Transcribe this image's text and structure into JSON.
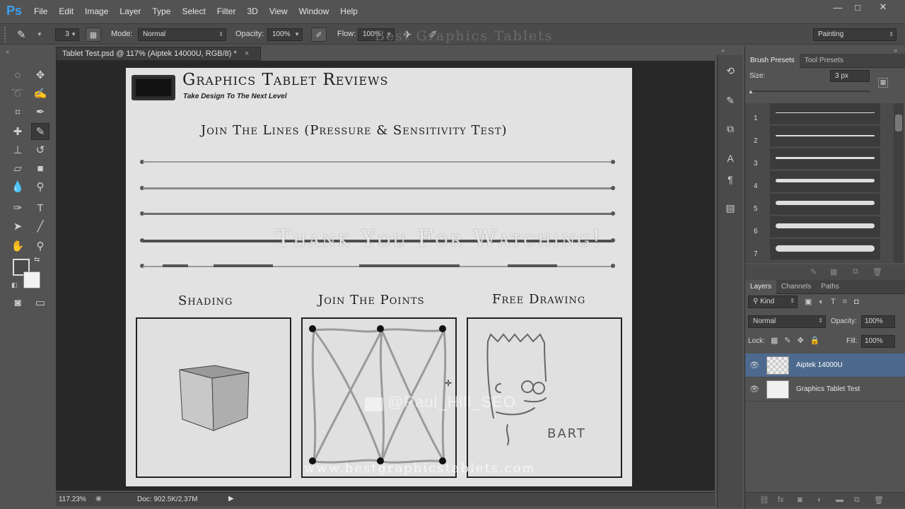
{
  "app": {
    "logo": "Ps"
  },
  "menu": [
    "File",
    "Edit",
    "Image",
    "Layer",
    "Type",
    "Select",
    "Filter",
    "3D",
    "View",
    "Window",
    "Help"
  ],
  "window_controls": {
    "minimize": "—",
    "maximize": "□",
    "close": "✕"
  },
  "options": {
    "brush_size": "3",
    "mode_label": "Mode:",
    "mode_value": "Normal",
    "opacity_label": "Opacity:",
    "opacity_value": "100%",
    "flow_label": "Flow:",
    "flow_value": "100%",
    "workspace": "Painting"
  },
  "watermark_top": "Best Graphics Tablets",
  "document": {
    "tab_title": "Tablet Test.psd @ 117% (Aiptek 14000U, RGB/8) *",
    "tab_close": "×",
    "header_title": "Graphics Tablet Reviews",
    "header_tagline": "Take Design To The Next Level",
    "section_lines": "Join The Lines (Pressure & Sensitivity Test)",
    "section_shading": "Shading",
    "section_points": "Join The Points",
    "section_free": "Free Drawing",
    "drawing_label": "BART",
    "overlay_thanks": "Thank You For Watching!",
    "overlay_handle": "@Paul_Hill_SEO",
    "overlay_url": "www.bestgraphicstablets.com"
  },
  "status": {
    "zoom": "117.23%",
    "doc": "Doc: 902.5K/2.37M"
  },
  "brush_panel": {
    "tabs": [
      "Brush Presets",
      "Tool Presets"
    ],
    "size_label": "Size:",
    "size_value": "3 px",
    "presets": [
      "1",
      "2",
      "3",
      "4",
      "5",
      "6",
      "7"
    ]
  },
  "layers_panel": {
    "tabs": [
      "Layers",
      "Channels",
      "Paths"
    ],
    "filter_kind": "Kind",
    "blend_mode": "Normal",
    "opacity_label": "Opacity:",
    "opacity_value": "100%",
    "lock_label": "Lock:",
    "fill_label": "Fill:",
    "fill_value": "100%",
    "layers": [
      {
        "name": "Aiptek 14000U",
        "selected": true
      },
      {
        "name": "Graphics Tablet Test",
        "selected": false
      }
    ]
  }
}
